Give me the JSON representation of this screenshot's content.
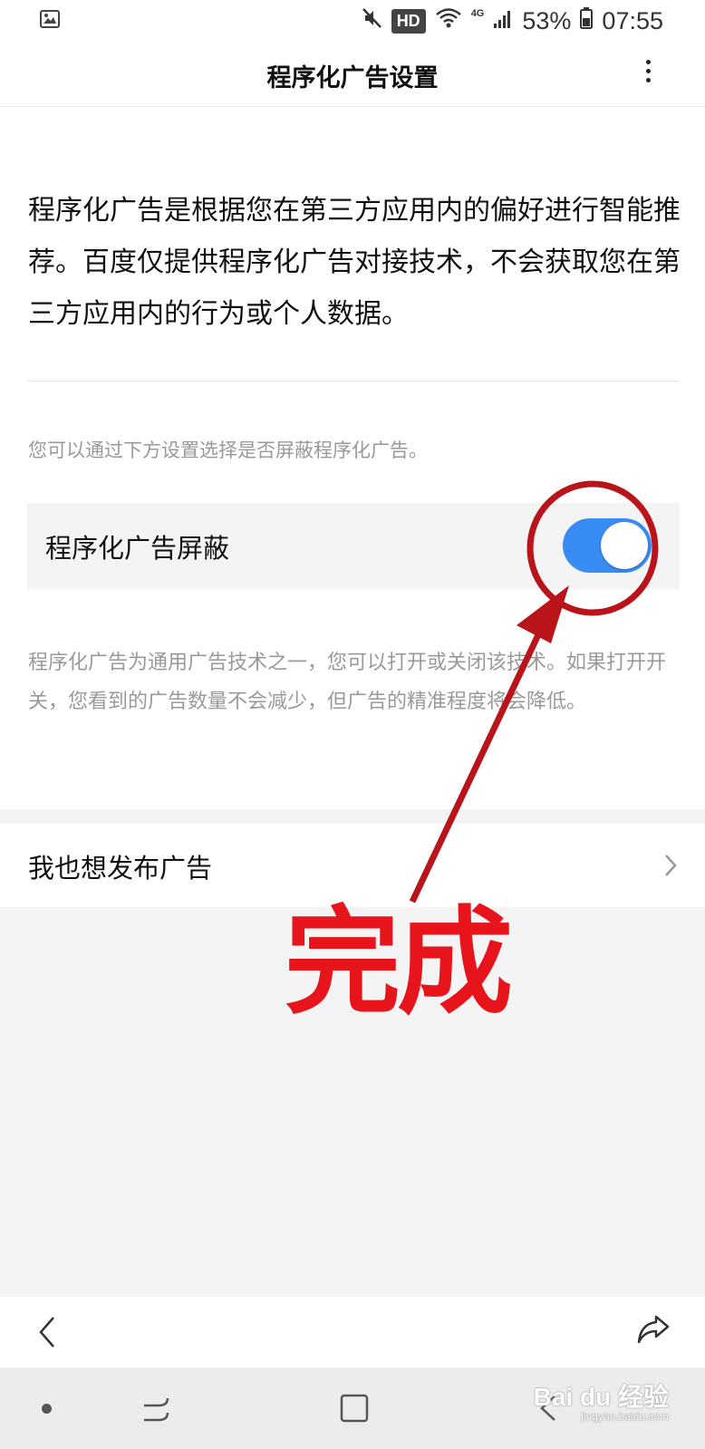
{
  "status_bar": {
    "network": "4G",
    "hd_label": "HD",
    "battery": "53%",
    "time": "07:55"
  },
  "header": {
    "title": "程序化广告设置",
    "menu_icon": "more-vertical-icon"
  },
  "main": {
    "intro": "程序化广告是根据您在第三方应用内的偏好进行智能推荐。百度仅提供程序化广告对接技术，不会获取您在第三方应用内的行为或个人数据。",
    "hint": "您可以通过下方设置选择是否屏蔽程序化广告。",
    "toggle": {
      "label": "程序化广告屏蔽",
      "state": "on",
      "accent": "#3a8cf5"
    },
    "description": "程序化广告为通用广告技术之一，您可以打开或关闭该技术。如果打开开关，您看到的广告数量不会减少，但广告的精准程度将会降低。"
  },
  "publish": {
    "label": "我也想发布广告"
  },
  "toolbar": {
    "back_icon": "chevron-left-icon",
    "share_icon": "share-icon"
  },
  "annotation": {
    "text": "完成",
    "color": "#e8141c"
  },
  "watermark": {
    "brand": "Bai du 经验",
    "site": "jingyan.baidu.com"
  }
}
